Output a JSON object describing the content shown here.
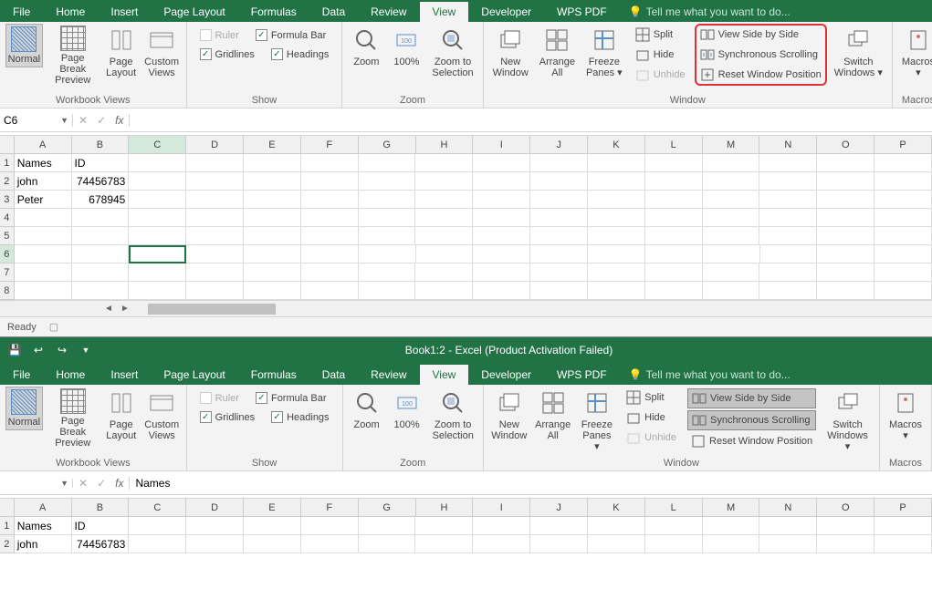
{
  "app": {
    "titlebar": "Book1:2 - Excel (Product Activation Failed)",
    "tabs": [
      "File",
      "Home",
      "Insert",
      "Page Layout",
      "Formulas",
      "Data",
      "Review",
      "View",
      "Developer",
      "WPS PDF"
    ],
    "active_tab": "View",
    "tell_me": "Tell me what you want to do..."
  },
  "ribbon": {
    "groups": {
      "workbook_views": {
        "label": "Workbook Views",
        "items": {
          "normal": "Normal",
          "page_break": "Page Break\nPreview",
          "page_layout": "Page\nLayout",
          "custom": "Custom\nViews"
        }
      },
      "show": {
        "label": "Show",
        "checks": {
          "ruler": "Ruler",
          "formula_bar": "Formula Bar",
          "gridlines": "Gridlines",
          "headings": "Headings"
        }
      },
      "zoom": {
        "label": "Zoom",
        "items": {
          "zoom": "Zoom",
          "p100": "100%",
          "zoom_sel": "Zoom to\nSelection"
        }
      },
      "window": {
        "label": "Window",
        "items": {
          "new_win": "New\nWindow",
          "arrange": "Arrange\nAll",
          "freeze": "Freeze\nPanes ▾",
          "split": "Split",
          "hide": "Hide",
          "unhide": "Unhide",
          "side": "View Side by Side",
          "sync": "Synchronous Scrolling",
          "reset": "Reset Window Position",
          "switch": "Switch\nWindows ▾"
        }
      },
      "macros": {
        "label": "Macros",
        "items": {
          "macros": "Macros\n▾"
        }
      }
    }
  },
  "window1": {
    "name_box": "C6",
    "formula": "",
    "columns": [
      "A",
      "B",
      "C",
      "D",
      "E",
      "F",
      "G",
      "H",
      "I",
      "J",
      "K",
      "L",
      "M",
      "N",
      "O",
      "P"
    ],
    "rows": [
      {
        "num": "1",
        "cells": [
          "Names",
          "ID",
          "",
          "",
          "",
          "",
          "",
          "",
          "",
          "",
          "",
          "",
          "",
          "",
          "",
          ""
        ]
      },
      {
        "num": "2",
        "cells": [
          "john",
          "74456783",
          "",
          "",
          "",
          "",
          "",
          "",
          "",
          "",
          "",
          "",
          "",
          "",
          "",
          ""
        ]
      },
      {
        "num": "3",
        "cells": [
          "Peter",
          "678945",
          "",
          "",
          "",
          "",
          "",
          "",
          "",
          "",
          "",
          "",
          "",
          "",
          "",
          ""
        ]
      },
      {
        "num": "4",
        "cells": [
          "",
          "",
          "",
          "",
          "",
          "",
          "",
          "",
          "",
          "",
          "",
          "",
          "",
          "",
          "",
          ""
        ]
      },
      {
        "num": "5",
        "cells": [
          "",
          "",
          "",
          "",
          "",
          "",
          "",
          "",
          "",
          "",
          "",
          "",
          "",
          "",
          "",
          ""
        ]
      },
      {
        "num": "6",
        "cells": [
          "",
          "",
          "",
          "",
          "",
          "",
          "",
          "",
          "",
          "",
          "",
          "",
          "",
          "",
          "",
          ""
        ]
      },
      {
        "num": "7",
        "cells": [
          "",
          "",
          "",
          "",
          "",
          "",
          "",
          "",
          "",
          "",
          "",
          "",
          "",
          "",
          "",
          ""
        ]
      },
      {
        "num": "8",
        "cells": [
          "",
          "",
          "",
          "",
          "",
          "",
          "",
          "",
          "",
          "",
          "",
          "",
          "",
          "",
          "",
          ""
        ]
      }
    ],
    "status": "Ready",
    "active_cell": {
      "row": 5,
      "col": 2
    }
  },
  "window2": {
    "name_box": "",
    "formula": "Names",
    "columns": [
      "A",
      "B",
      "C",
      "D",
      "E",
      "F",
      "G",
      "H",
      "I",
      "J",
      "K",
      "L",
      "M",
      "N",
      "O",
      "P"
    ],
    "rows": [
      {
        "num": "1",
        "cells": [
          "Names",
          "ID",
          "",
          "",
          "",
          "",
          "",
          "",
          "",
          "",
          "",
          "",
          "",
          "",
          "",
          ""
        ]
      },
      {
        "num": "2",
        "cells": [
          "john",
          "74456783",
          "",
          "",
          "",
          "",
          "",
          "",
          "",
          "",
          "",
          "",
          "",
          "",
          "",
          ""
        ]
      }
    ]
  }
}
